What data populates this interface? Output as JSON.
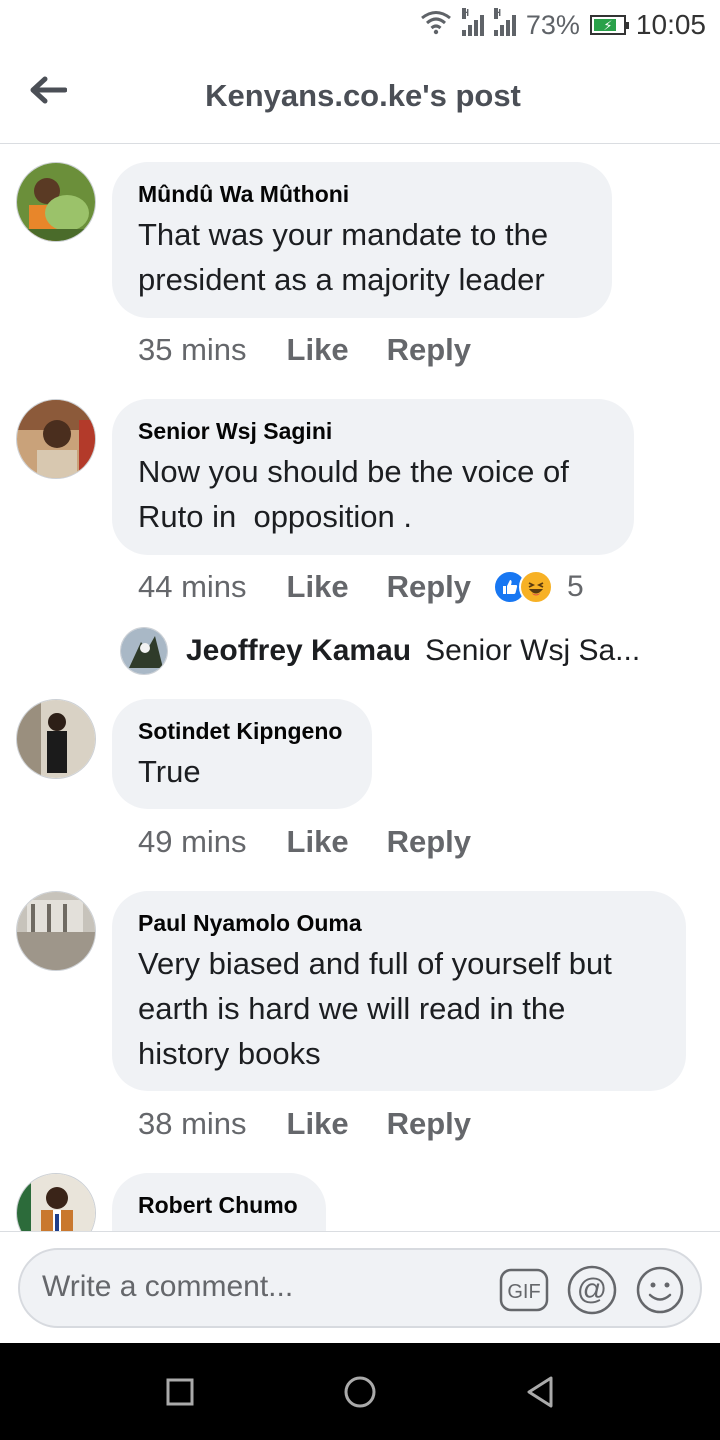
{
  "status_bar": {
    "battery": "73%",
    "time": "10:05",
    "icons": [
      "wifi-icon",
      "signal-icon",
      "signal-icon",
      "battery-charging-icon"
    ]
  },
  "header": {
    "title": "Kenyans.co.ke's post",
    "back_icon": "arrow-left-icon"
  },
  "comments": [
    {
      "author": "Mûndû Wa Mûthoni",
      "text_lines": [
        "That was your mandate to the",
        "president as a majority leader"
      ],
      "time": "35 mins",
      "like": "Like",
      "reply": "Reply"
    },
    {
      "author": "Senior Wsj Sagini",
      "text_lines": [
        "Now you should be the voice of",
        "Ruto in  opposition ."
      ],
      "time": "44 mins",
      "like": "Like",
      "reply": "Reply",
      "reaction_count": "5",
      "reactions": [
        "like-reaction-icon",
        "haha-reaction-icon"
      ],
      "reply_preview": {
        "author": "Jeoffrey Kamau",
        "text": "Senior Wsj Sa..."
      }
    },
    {
      "author": "Sotindet Kipngeno",
      "text_lines": [
        "True"
      ],
      "time": "49 mins",
      "like": "Like",
      "reply": "Reply"
    },
    {
      "author": "Paul Nyamolo Ouma",
      "text_lines": [
        "Very biased and full of yourself but",
        "earth is hard we will read in the",
        "history books"
      ],
      "time": "38 mins",
      "like": "Like",
      "reply": "Reply"
    },
    {
      "author": "Robert Chumo"
    }
  ],
  "composer": {
    "placeholder": "Write a comment...",
    "icons": [
      "gif-icon",
      "mention-icon",
      "emoji-icon"
    ]
  },
  "nav": {
    "icons": [
      "recent-apps-icon",
      "home-icon",
      "back-triangle-icon"
    ]
  }
}
